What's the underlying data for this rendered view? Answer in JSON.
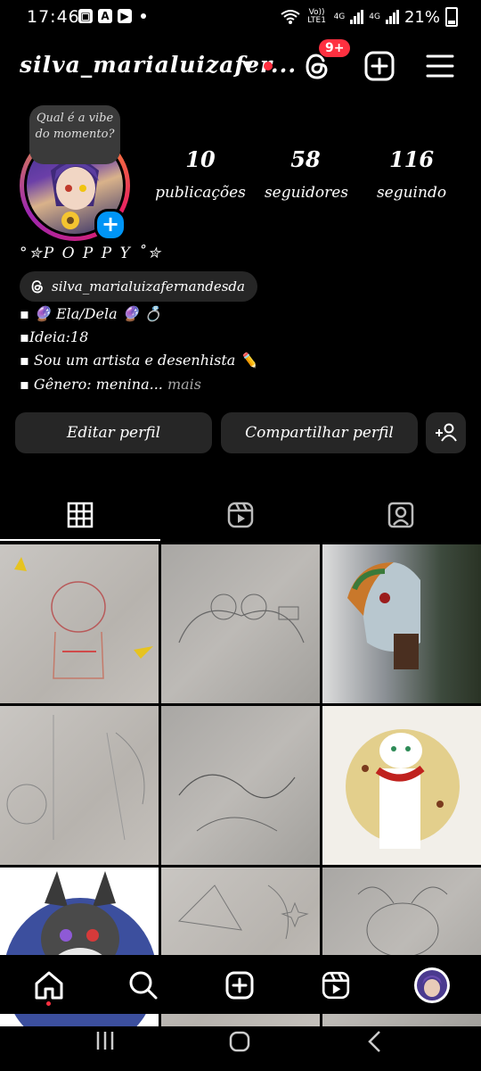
{
  "status_bar": {
    "time": "17:46",
    "left_icons": [
      "gallery-icon",
      "a-app-icon",
      "youtube-icon"
    ],
    "carrier_1": "Vo)) LTE1",
    "net_1": "4G",
    "net_2": "4G",
    "battery_pct": "21%"
  },
  "header": {
    "username": "silva_marialuizafer...",
    "threads_badge": "9+",
    "icons": [
      "threads-icon",
      "new-post-icon",
      "menu-icon"
    ]
  },
  "profile": {
    "note_bubble": "Qual é a vibe do momento?",
    "display_name": "°✮P O P P Y ˚✮",
    "threads_handle": "silva_marialuizafernandesda",
    "stats": [
      {
        "num": "10",
        "label": "publicações"
      },
      {
        "num": "58",
        "label": "seguidores"
      },
      {
        "num": "116",
        "label": "seguindo"
      }
    ],
    "bio": [
      "▪ 🔮 Ela/Dela 🔮 💍",
      "▪Ideia:18",
      "▪ Sou um artista e desenhista ✏️",
      "▪ Gênero: menina..."
    ],
    "bio_more": "mais"
  },
  "actions": {
    "edit": "Editar perfil",
    "share": "Compartilhar perfil"
  },
  "tabs": [
    "grid-tab",
    "reels-tab",
    "tagged-tab"
  ],
  "posts": [
    "sketch",
    "sketch",
    "pony-drawing",
    "sketch",
    "sketch",
    "cat-drawing",
    "wolf-drawing",
    "sketch",
    "sketch"
  ],
  "bottom_nav": [
    "home",
    "search",
    "create",
    "reels",
    "profile"
  ],
  "colors": {
    "accent": "#0095f6",
    "notification": "#ff3040",
    "button_bg": "#262626"
  }
}
